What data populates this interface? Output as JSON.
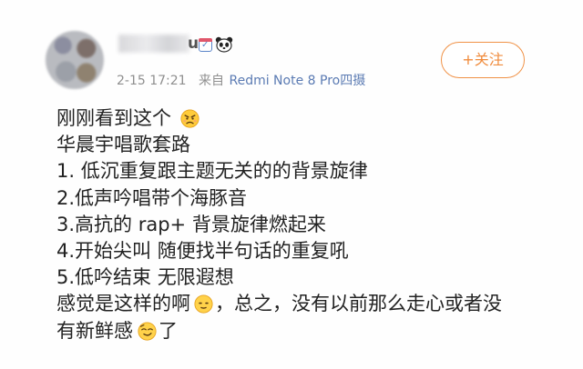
{
  "post": {
    "author_name_visible": "u",
    "timestamp": "2-15 17:21",
    "source_prefix": "来自",
    "device": "Redmi Note 8 Pro四摄",
    "follow_button_label": "+关注",
    "icons": {
      "calendar": "calendar-check-icon",
      "panda": "panda-icon",
      "emoji_angry": "angry-face-emoji",
      "emoji_awkward": "awkward-smile-emoji",
      "emoji_smug": "smug-face-emoji"
    },
    "lines": [
      "刚刚看到这个",
      "华晨宇唱歌套路",
      "1. 低沉重复跟主题无关的的背景旋律",
      "2.低声吟唱带个海豚音",
      "3.高抗的 rap+ 背景旋律燃起来",
      "4.开始尖叫 随便找半句话的重复吼",
      "5.低吟结束 无限遐想",
      "感觉是这样的啊",
      "，总之，没有以前那么走心或者没",
      "有新鲜感",
      "了"
    ]
  }
}
